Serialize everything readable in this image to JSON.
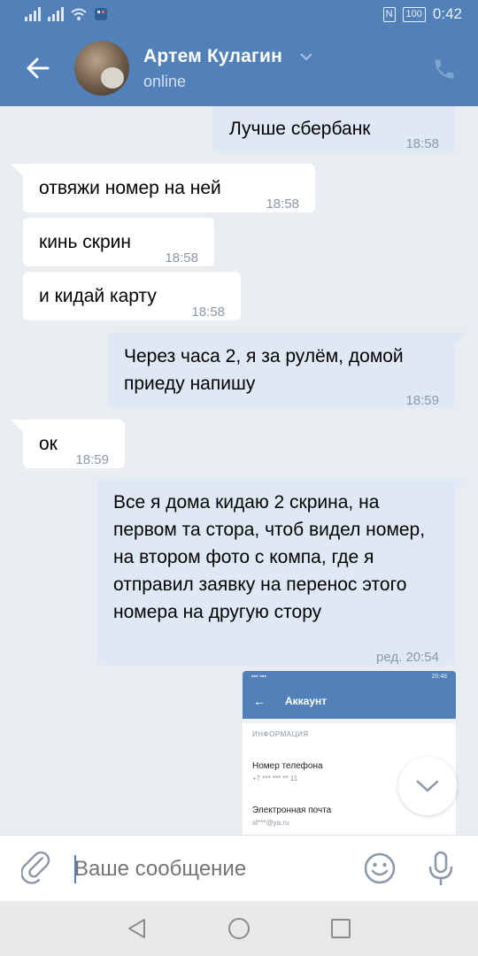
{
  "statusbar": {
    "battery": "100",
    "time": "0:42"
  },
  "header": {
    "name": "Артем Кулагин",
    "status": "online"
  },
  "messages": [
    {
      "dir": "out",
      "text": "Лучше сбербанк",
      "time": "18:58"
    },
    {
      "dir": "in",
      "text": "отвяжи номер на ней",
      "time": "18:58"
    },
    {
      "dir": "in",
      "text": "кинь скрин",
      "time": "18:58"
    },
    {
      "dir": "in",
      "text": "и кидай карту",
      "time": "18:58"
    },
    {
      "dir": "out",
      "text": "Через часа 2, я за рулём, домой приеду напишу",
      "time": "18:59"
    },
    {
      "dir": "in",
      "text": "ок",
      "time": "18:59"
    },
    {
      "dir": "out",
      "text": "Все я дома кидаю 2 скрина, на первом та стора, чтоб видел номер, на втором фото с компа, где я отправил заявку на перенос этого номера на другую стору",
      "time": "ред. 20:54"
    }
  ],
  "preview": {
    "status_time": "20:48",
    "title": "Аккаунт",
    "section": "ИНФОРМАЦИЯ",
    "phone_label": "Номер телефона",
    "phone_value": "+7 *** *** ** 11",
    "email_label": "Электронная почта",
    "email_value": "st***@ya.ru"
  },
  "composer": {
    "placeholder": "Ваше сообщение"
  },
  "colors": {
    "header": "#5181b8",
    "bubble_in": "#ffffff",
    "bubble_out": "#dfe9f6",
    "background": "#e9edf2"
  },
  "icons": [
    "back-arrow-icon",
    "chevron-down-icon",
    "phone-icon",
    "scroll-down-icon",
    "paperclip-icon",
    "smile-icon",
    "mic-icon",
    "nav-back-icon",
    "nav-home-icon",
    "nav-recent-icon"
  ]
}
